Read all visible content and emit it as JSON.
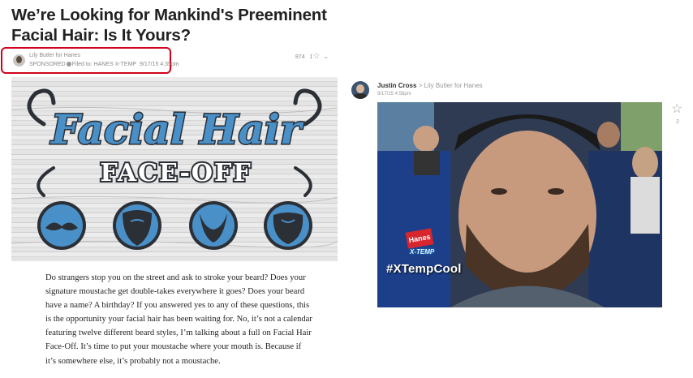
{
  "article": {
    "title": "We’re Looking for Mankind's Preeminent Facial Hair: Is It Yours?",
    "author": "Lily Butler for Hanes",
    "sponsored_label": "SPONSORED",
    "filed_label": "Filed to: HANES X-TEMP",
    "timestamp": "9/17/15 4:35pm",
    "views": "874",
    "stars": "1",
    "hero": {
      "line1": "Facial Hair",
      "line2": "FACE-OFF"
    },
    "body": "Do strangers stop you on the street and ask to stroke your beard? Does your signature moustache get double-takes everywhere it goes? Does your beard have a name? A birthday? If you answered yes to any of these questions, this is the opportunity your facial hair has been waiting for. No, it’s not a calendar featuring twelve different beard styles, I’m talking about a full on Facial Hair Face-Off. It’s time to put your moustache where your mouth is. Because if it’s somewhere else, it’s probably not a moustache."
  },
  "reply": {
    "author": "Justin Cross",
    "arrow": ">",
    "to": "Lily Butler for Hanes",
    "timestamp": "9/17/15 4:58pm",
    "photo_brand": "Hanes",
    "photo_sub": "X-TEMP",
    "hashtag": "#XTempCool",
    "star_count": "2"
  },
  "colors": {
    "highlight_border": "#d0021b",
    "hero_blue": "#4a90c8",
    "hero_dark": "#2b2f36"
  },
  "icons": [
    "avatar",
    "star-icon",
    "chevron-down-icon",
    "dot-icon"
  ]
}
